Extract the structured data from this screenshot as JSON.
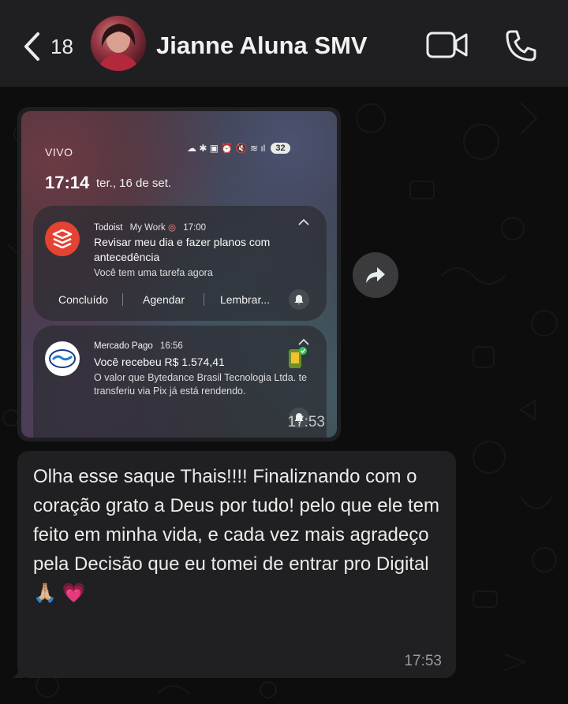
{
  "header": {
    "unread_count": "18",
    "contact_name": "Jianne Aluna SMV",
    "icons": [
      "back-arrow-icon",
      "video-call-icon",
      "voice-call-icon"
    ]
  },
  "image_message": {
    "screenshot": {
      "carrier": "VIVO",
      "battery": "32",
      "clock": "17:14",
      "date": "ter., 16 de set.",
      "notifications": [
        {
          "app": "Todoist",
          "context": "My Work",
          "time": "17:00",
          "title": "Revisar meu dia e fazer planos com antecedência",
          "body": "Você tem uma tarefa agora",
          "actions": [
            "Concluído",
            "Agendar",
            "Lembrar..."
          ]
        },
        {
          "app": "Mercado Pago",
          "time": "16:56",
          "title": "Você recebeu R$ 1.574,41",
          "body": "O valor que Bytedance Brasil Tecnologia Ltda. te transferiu via Pix já está rendendo."
        }
      ]
    },
    "timestamp": "17:53"
  },
  "text_message": {
    "text": "Olha esse saque Thais!!!! Finaliznando com o coração grato a Deus por tudo! pelo que ele tem feito em minha vida, e cada vez mais agradeço pela Decisão que eu tomei de entrar pro Digital 🙏🏼 💗",
    "timestamp": "17:53"
  }
}
